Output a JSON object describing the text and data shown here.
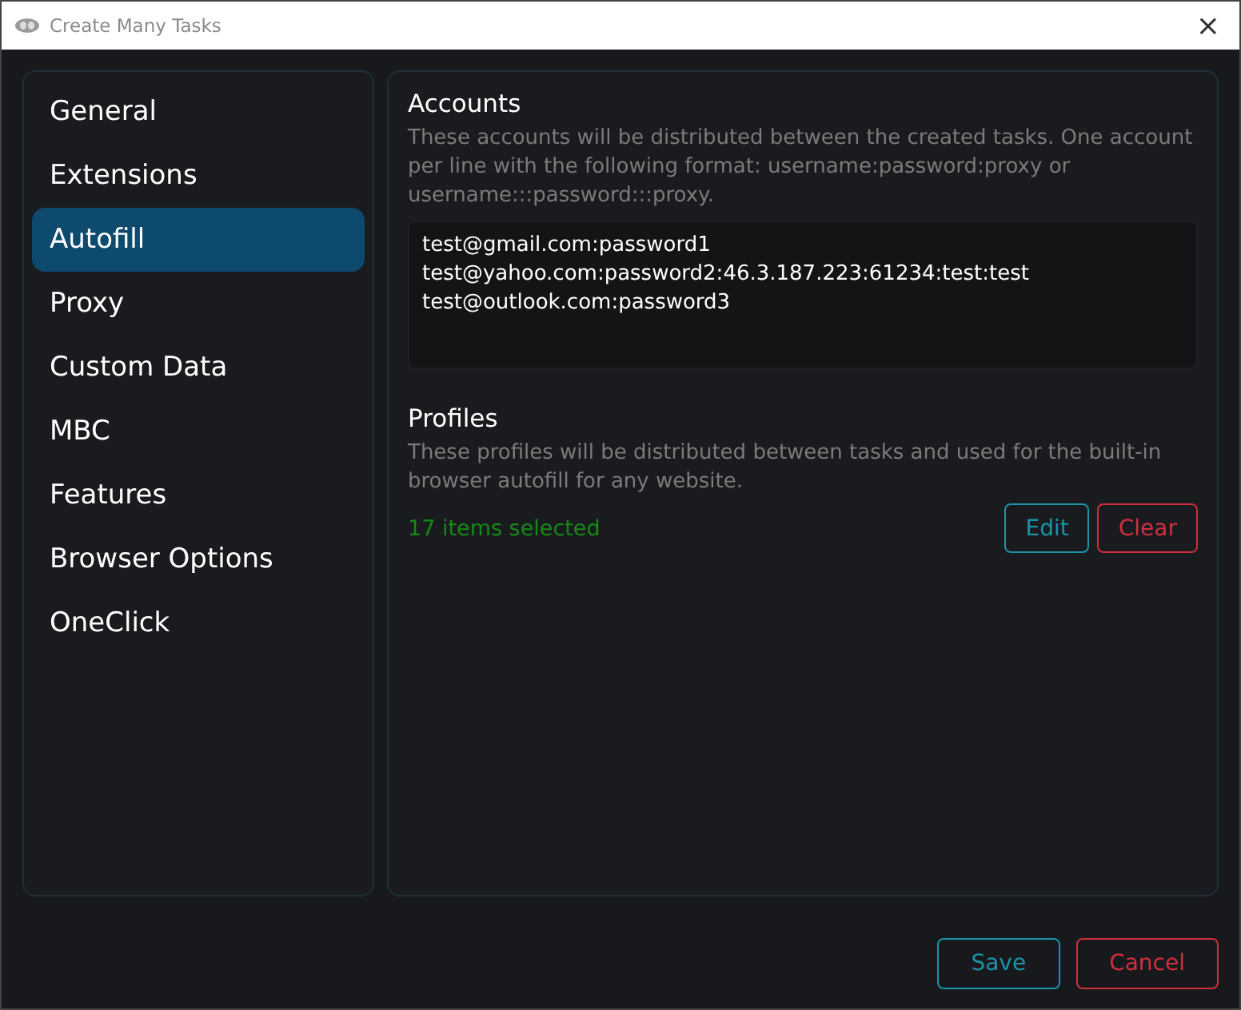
{
  "window": {
    "title": "Create Many Tasks",
    "close": "×"
  },
  "sidebar": {
    "items": [
      {
        "label": "General",
        "selected": false
      },
      {
        "label": "Extensions",
        "selected": false
      },
      {
        "label": "Autofill",
        "selected": true
      },
      {
        "label": "Proxy",
        "selected": false
      },
      {
        "label": "Custom Data",
        "selected": false
      },
      {
        "label": "MBC",
        "selected": false
      },
      {
        "label": "Features",
        "selected": false
      },
      {
        "label": "Browser Options",
        "selected": false
      },
      {
        "label": "OneClick",
        "selected": false
      }
    ]
  },
  "accounts": {
    "title": "Accounts",
    "description": "These accounts will be distributed between the created tasks. One account per line with the following format: username:password:proxy or username:::password:::proxy.",
    "value": "test@gmail.com:password1\ntest@yahoo.com:password2:46.3.187.223:61234:test:test\ntest@outlook.com:password3"
  },
  "profiles": {
    "title": "Profiles",
    "description": "These profiles will be distributed between tasks and used for the built-in browser autofill for any website.",
    "status": "17 items selected",
    "buttons": [
      {
        "label": "Edit",
        "kind": "primary"
      },
      {
        "label": "Clear",
        "kind": "danger"
      }
    ]
  },
  "footer": {
    "buttons": [
      {
        "label": "Save",
        "kind": "primary"
      },
      {
        "label": "Cancel",
        "kind": "danger"
      }
    ]
  }
}
